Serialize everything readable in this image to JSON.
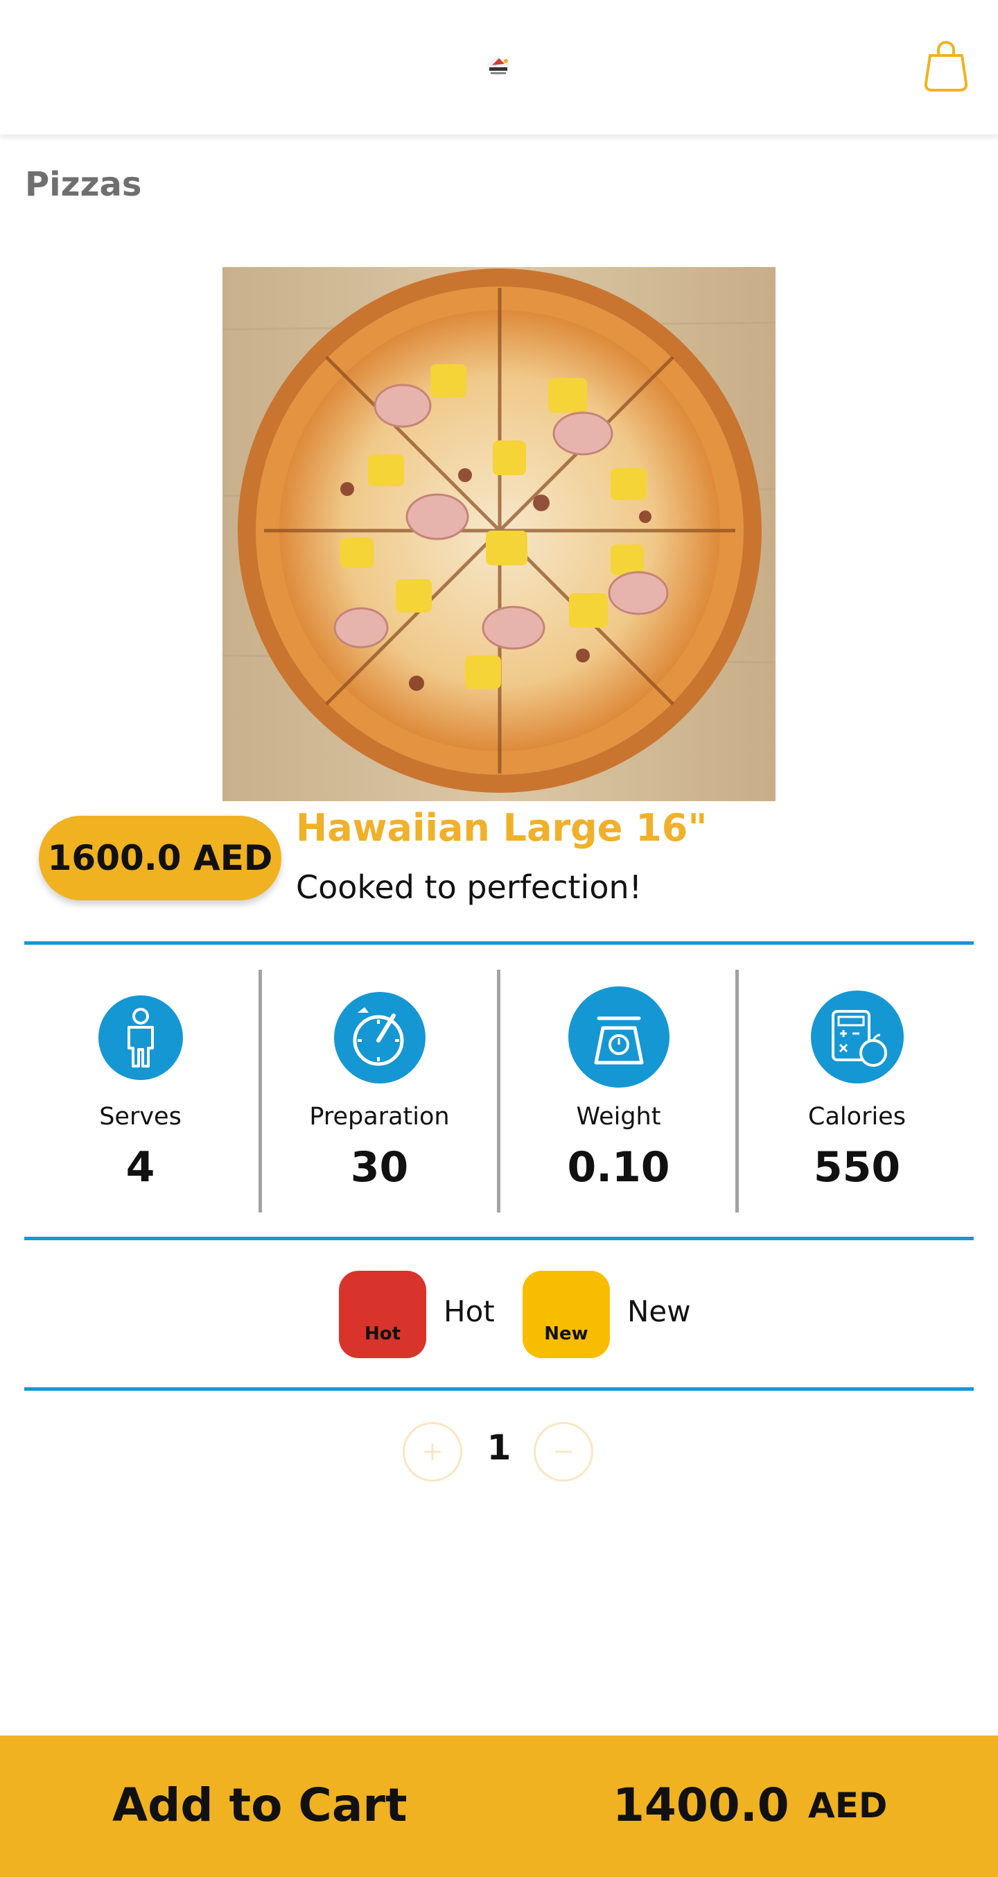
{
  "colors": {
    "accent": "#f1b221",
    "title": "#f0b02a",
    "divider": "#1597d4",
    "hot": "#d9342b",
    "new": "#f9bd00"
  },
  "header": {
    "logo_icon": "restaurant-logo",
    "cart_icon": "shopping-bag-icon"
  },
  "category": "Pizzas",
  "product": {
    "image_icon": "pizza-photo",
    "price": "1600.0 AED",
    "name": "Hawaiian Large 16\"",
    "description": "Cooked to perfection!"
  },
  "stats": [
    {
      "label": "Serves",
      "value": "4",
      "icon": "person-icon"
    },
    {
      "label": "Preparation",
      "value": "30",
      "icon": "timer-icon"
    },
    {
      "label": "Weight",
      "value": "0.10",
      "icon": "scale-icon"
    },
    {
      "label": "Calories",
      "value": "550",
      "icon": "calculator-apple-icon"
    }
  ],
  "badges": [
    {
      "badge_text": "Hot",
      "label": "Hot"
    },
    {
      "badge_text": "New",
      "label": "New"
    }
  ],
  "quantity": {
    "value": "1",
    "plus_icon": "plus-icon",
    "minus_icon": "minus-icon"
  },
  "add_to_cart": {
    "label": "Add to Cart",
    "total": "1400.0",
    "currency": "AED"
  }
}
